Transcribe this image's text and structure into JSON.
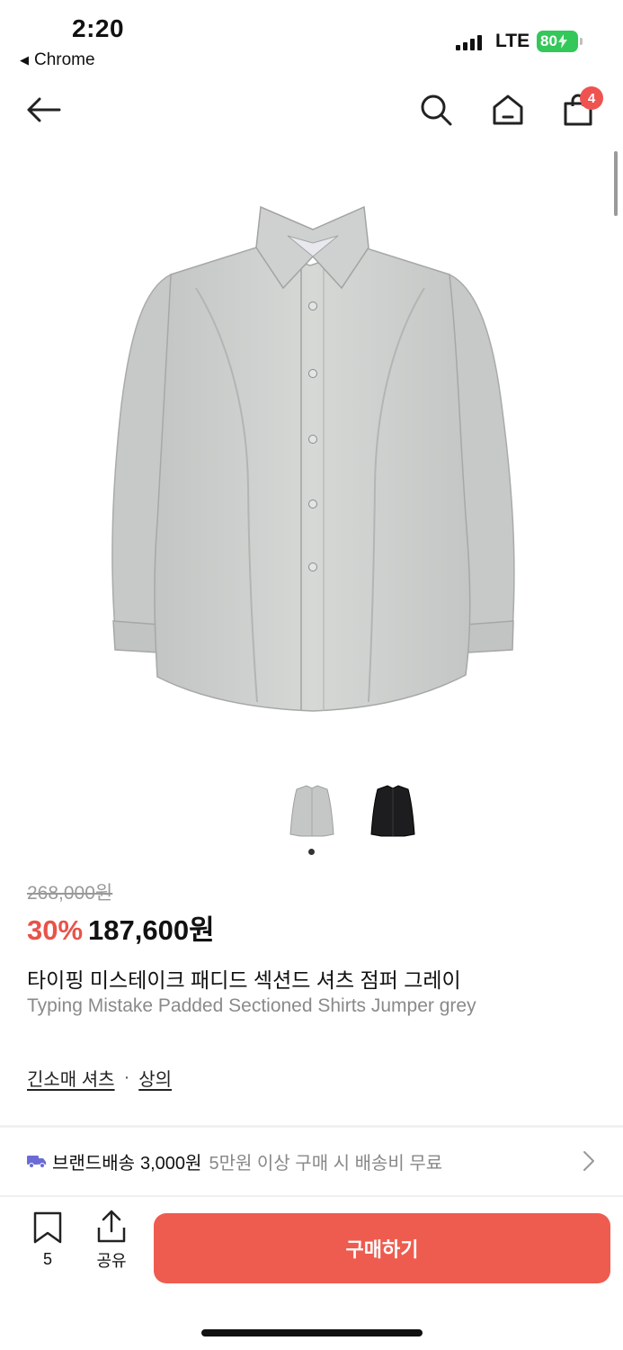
{
  "status": {
    "time": "2:20",
    "back_app": "Chrome",
    "network": "LTE",
    "battery": "80"
  },
  "nav": {
    "cart_count": "4"
  },
  "product": {
    "original_price": "268,000원",
    "discount": "30%",
    "price": "187,600원",
    "title_ko": "타이핑 미스테이크 패디드 섹션드 셔츠 점퍼 그레이",
    "title_en": "Typing Mistake Padded Sectioned Shirts Jumper grey",
    "categories": [
      "긴소매 셔츠",
      "상의"
    ],
    "category_separator": "·",
    "thumbnails": [
      "grey",
      "black"
    ],
    "image_page": 1,
    "image_count": 2
  },
  "shipping": {
    "title": "브랜드배송",
    "fee": "3,000원",
    "note": "5만원 이상 구매 시 배송비 무료"
  },
  "bottom": {
    "bookmark_count": "5",
    "share_label": "공유",
    "buy_label": "구매하기"
  },
  "colors": {
    "accent": "#ee5c4f",
    "discount": "#e8534a",
    "badge": "#ef5350",
    "battery": "#34c759",
    "truck": "#6b6bd6"
  }
}
